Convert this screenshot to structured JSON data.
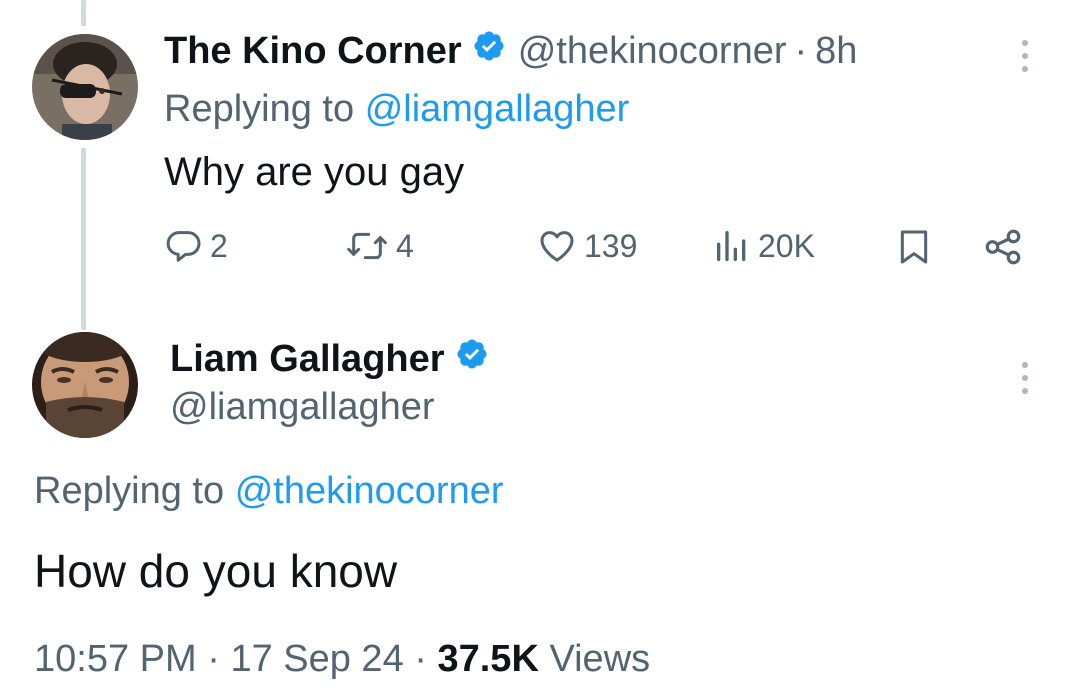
{
  "reply_tweet": {
    "display_name": "The Kino Corner",
    "handle": "@thekinocorner",
    "separator": "·",
    "time": "8h",
    "replying_prefix": "Replying to",
    "replying_to": "@liamgallagher",
    "text": "Why are you gay",
    "stats": {
      "replies": "2",
      "reposts": "4",
      "likes": "139",
      "views": "20K"
    },
    "avatar_icon": "user-avatar-eyepatch"
  },
  "main_tweet": {
    "display_name": "Liam Gallagher",
    "handle": "@liamgallagher",
    "replying_prefix": "Replying to",
    "replying_to": "@thekinocorner",
    "text": "How do you know",
    "timestamp_time": "10:57 PM",
    "separator": "·",
    "timestamp_date": "17 Sep 24",
    "views_count": "37.5K",
    "views_label": "Views",
    "avatar_icon": "user-avatar-bearded"
  },
  "icons": {
    "verified": "verified-badge-icon",
    "reply": "reply-icon",
    "repost": "repost-icon",
    "like": "heart-icon",
    "views": "views-chart-icon",
    "bookmark": "bookmark-icon",
    "share": "share-icon",
    "more": "more-vertical-icon"
  },
  "colors": {
    "accent": "#1d9bf0",
    "text_primary": "#0f1419",
    "text_secondary": "#536471",
    "thread_line": "#cfd9de"
  }
}
